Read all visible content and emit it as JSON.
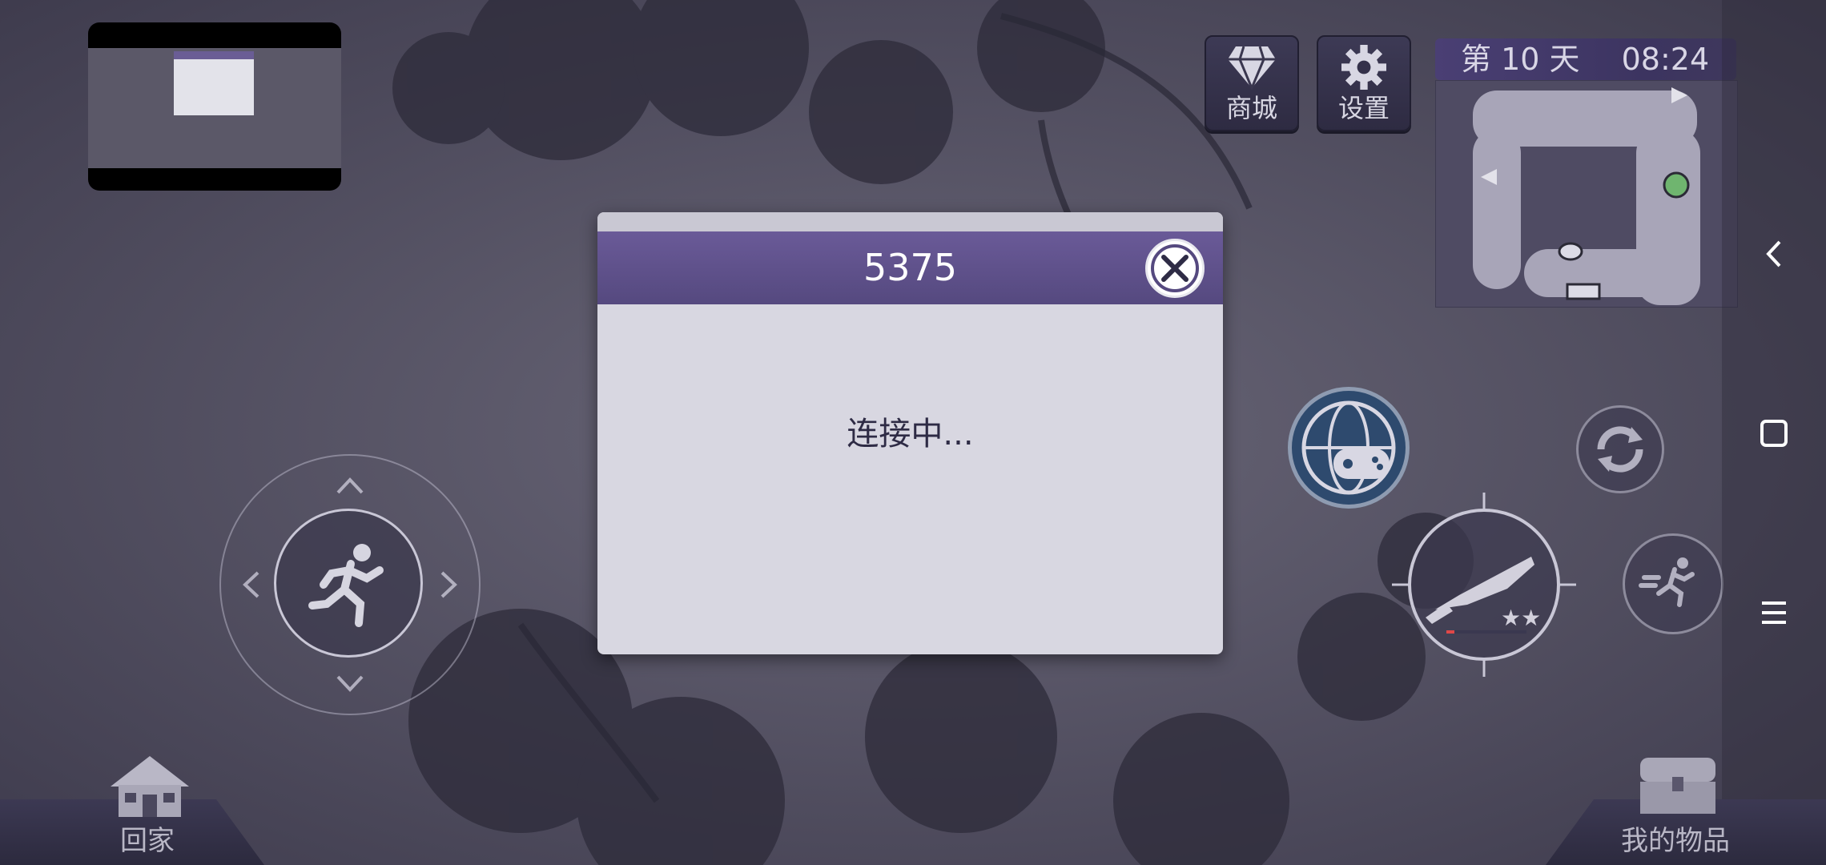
{
  "preview": {
    "dialog_close": "⊗"
  },
  "top_buttons": {
    "shop_label": "商城",
    "settings_label": "设置"
  },
  "status": {
    "day_label": "第 10 天",
    "time": "08:24"
  },
  "dialog": {
    "title": "5375",
    "message": "连接中..."
  },
  "bottom": {
    "home_label": "回家",
    "items_label": "我的物品"
  },
  "icons": {
    "shop": "diamond-icon",
    "settings": "gear-icon",
    "close": "close-icon",
    "run": "running-person-icon",
    "online": "globe-gamepad-icon",
    "refresh": "refresh-icon",
    "weapon": "knife-icon",
    "sprint": "sprint-icon",
    "home": "house-icon",
    "inventory": "chest-icon",
    "back": "chevron-left-icon",
    "recents": "square-icon",
    "menu": "menu-icon"
  },
  "colors": {
    "dialog_header": "#5e5088",
    "background": "#4d4a5c",
    "accent_blue": "#2e4a6e"
  },
  "weapon": {
    "stars": 2
  }
}
